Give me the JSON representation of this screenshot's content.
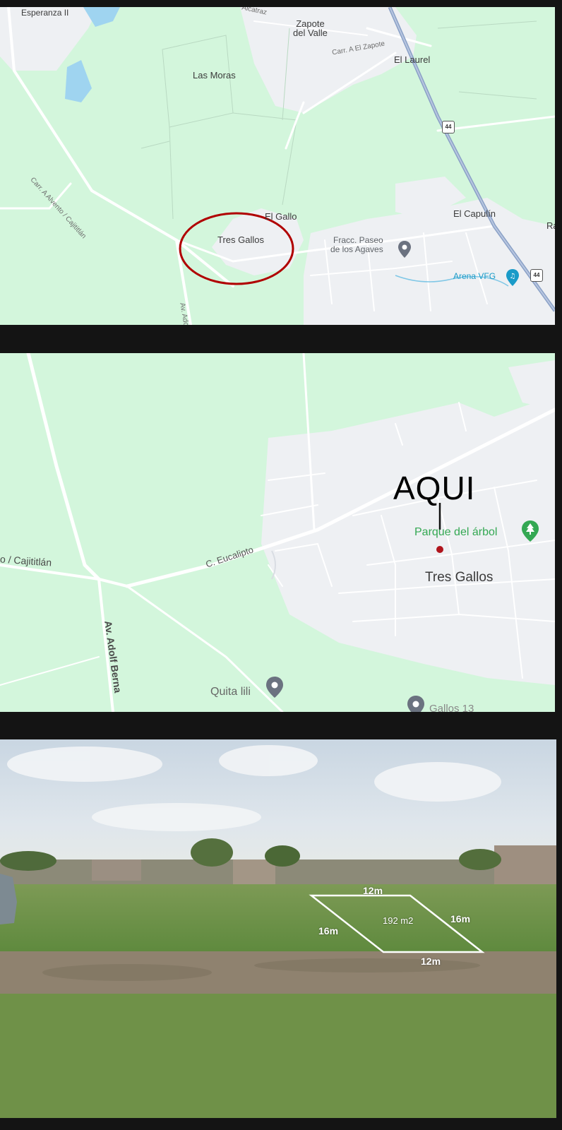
{
  "map1": {
    "places": {
      "esperanza": "Esperanza II",
      "zapote": "Zapote\ndel Valle",
      "laurel": "El Laurel",
      "moras": "Las Moras",
      "gallo": "El Gallo",
      "tres_gallos": "Tres Gallos",
      "capulin": "El Capulín",
      "ra": "Ra"
    },
    "roads": {
      "alcatraz": "Alcatraz",
      "carr_zapote": "Carr. A El Zapote",
      "carr_alvento": "Carr. A Alvento / Cajititlán",
      "av_adolf": "Av. Adolf"
    },
    "pois": {
      "fracc": "Fracc. Paseo\nde los Agaves",
      "arena": "Arena VFG"
    },
    "shields": {
      "hwy_a": "44",
      "hwy_b": "44"
    }
  },
  "map2": {
    "places": {
      "tres_gallos": "Tres Gallos",
      "parque": "Parque del árbol",
      "quita": "Quita lili",
      "gallos13": "Gallos 13"
    },
    "roads": {
      "cajititlan": "o / Cajititlán",
      "eucalipto": "C. Eucalipto",
      "av_adolf": "Av. Adolf Berna"
    },
    "annotation": "AQUI"
  },
  "photo": {
    "measurements": {
      "top": "12m",
      "left": "16m",
      "right": "16m",
      "bottom": "12m",
      "area": "192 m2"
    }
  },
  "colors": {
    "land": "#d3f6dc",
    "road": "#ffffff",
    "urban": "#eef0f3",
    "water": "#9fd4f0",
    "circle": "#b00000",
    "highway": "#8aa1c6",
    "park_pin": "#34a853",
    "arena_pin": "#1a9bc8",
    "pin_gray": "#6b7280"
  }
}
